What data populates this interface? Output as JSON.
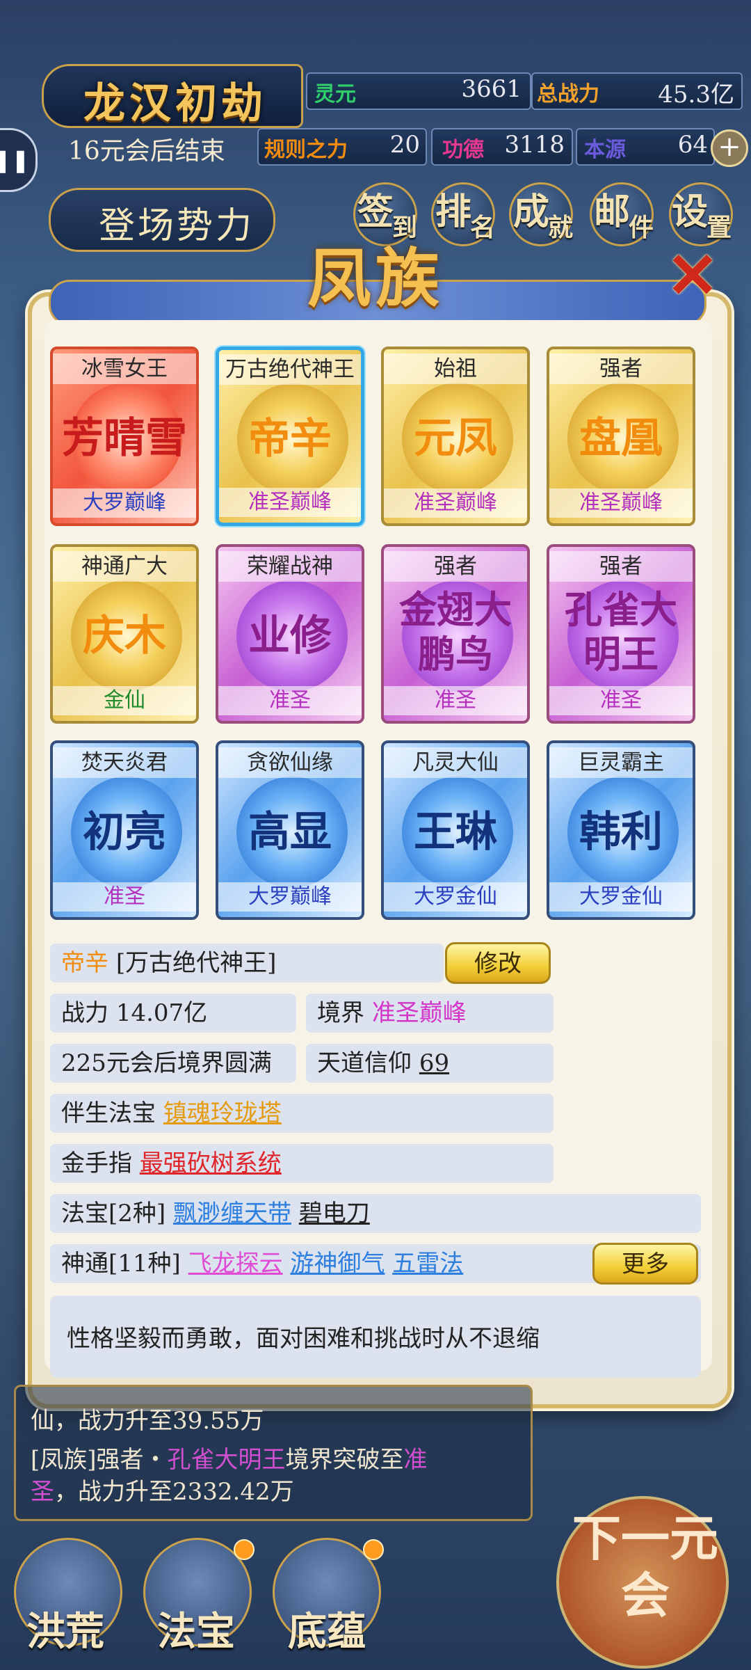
{
  "hud": {
    "title": "龙汉初劫",
    "subtitle": "16元会后结束",
    "stats": [
      {
        "label": "灵元",
        "value": "3661",
        "color": "#2fd06b"
      },
      {
        "label": "总战力",
        "value": "45.3亿",
        "color": "#f2a12a"
      },
      {
        "label": "规则之力",
        "value": "20",
        "color": "#f28c0f"
      },
      {
        "label": "功德",
        "value": "3118",
        "color": "#e7388f"
      },
      {
        "label": "本源",
        "value": "64",
        "color": "#6b5bdc"
      }
    ],
    "force_button": "登场势力",
    "nav": [
      {
        "main": "签",
        "sub": "到"
      },
      {
        "main": "排",
        "sub": "名"
      },
      {
        "main": "成",
        "sub": "就"
      },
      {
        "main": "邮",
        "sub": "件"
      },
      {
        "main": "设",
        "sub": "置"
      }
    ]
  },
  "modal": {
    "title": "凤族",
    "cards": [
      {
        "rank": "冰雪女王",
        "name": "芳晴雪",
        "level": "大罗巅峰",
        "style": "red"
      },
      {
        "rank": "万古绝代神王",
        "name": "帝辛",
        "level": "准圣巅峰",
        "style": "gold-sel"
      },
      {
        "rank": "始祖",
        "name": "元凤",
        "level": "准圣巅峰",
        "style": "gold"
      },
      {
        "rank": "强者",
        "name": "盘凰",
        "level": "准圣巅峰",
        "style": "gold"
      },
      {
        "rank": "神通广大",
        "name": "庆木",
        "level": "金仙",
        "style": "gold"
      },
      {
        "rank": "荣耀战神",
        "name": "业修",
        "level": "准圣",
        "style": "purple"
      },
      {
        "rank": "强者",
        "name": "金翅大鹏鸟",
        "level": "准圣",
        "style": "purple"
      },
      {
        "rank": "强者",
        "name": "孔雀大明王",
        "level": "准圣",
        "style": "purple"
      },
      {
        "rank": "焚天炎君",
        "name": "初亮",
        "level": "准圣",
        "style": "blue"
      },
      {
        "rank": "贪欲仙缘",
        "name": "高显",
        "level": "大罗巅峰",
        "style": "blue"
      },
      {
        "rank": "凡灵大仙",
        "name": "王琳",
        "level": "大罗金仙",
        "style": "blue"
      },
      {
        "rank": "巨灵霸主",
        "name": "韩利",
        "level": "大罗金仙",
        "style": "blue"
      }
    ],
    "detail": {
      "name": "帝辛",
      "title": "[万古绝代神王]",
      "edit_button": "修改",
      "power_label": "战力",
      "power_value": "14.07亿",
      "realm_label": "境界",
      "realm_value": "准圣巅峰",
      "completion": "225元会后境界圆满",
      "faith_label": "天道信仰",
      "faith_value": "69",
      "treasure_label": "伴生法宝",
      "treasure_value": "镇魂玲珑塔",
      "finger_label": "金手指",
      "finger_value": "最强砍树系统",
      "artifacts_label": "法宝[2种]",
      "artifacts": [
        "飘渺缠天带",
        "碧电刀"
      ],
      "skills_label": "神通[11种]",
      "skills": [
        "飞龙探云",
        "游神御气",
        "五雷法"
      ],
      "more_button": "更多",
      "description": "性格坚毅而勇敢，面对困难和挑战时从不退缩"
    }
  },
  "log": {
    "line1_a": "仙，战力升至39.55万",
    "line2_a": "[凤族]强者・",
    "line2_name": "孔雀大明王",
    "line2_b": "境界突破至",
    "line2_level": "准",
    "line3_level": "圣",
    "line3_b": "，战力升至2332.42万"
  },
  "bottom": {
    "buttons": [
      "洪荒",
      "法宝",
      "底蕴"
    ],
    "next": "下一元会"
  }
}
